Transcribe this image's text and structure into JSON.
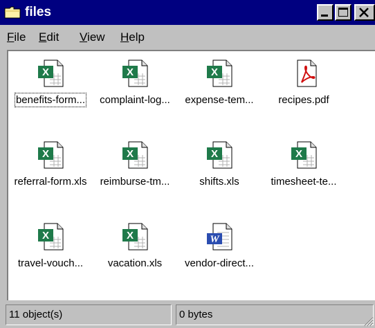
{
  "window": {
    "title": "files",
    "title_icon": "folder-icon",
    "buttons": [
      "minimize-icon",
      "maximize-icon",
      "close-icon"
    ]
  },
  "menu": {
    "items": [
      {
        "label": "File",
        "accel": "F",
        "rest": "ile"
      },
      {
        "label": "Edit",
        "accel": "E",
        "rest": "dit"
      },
      {
        "label": "View",
        "accel": "V",
        "rest": "iew"
      },
      {
        "label": "Help",
        "accel": "H",
        "rest": "elp"
      }
    ]
  },
  "files": [
    {
      "label": "benefits-form...",
      "type": "excel",
      "selected": true
    },
    {
      "label": "complaint-log...",
      "type": "excel"
    },
    {
      "label": "expense-tem...",
      "type": "excel"
    },
    {
      "label": "recipes.pdf",
      "type": "pdf"
    },
    {
      "label": "referral-form.xls",
      "type": "excel"
    },
    {
      "label": "reimburse-tm...",
      "type": "excel"
    },
    {
      "label": "shifts.xls",
      "type": "excel"
    },
    {
      "label": "timesheet-te...",
      "type": "excel"
    },
    {
      "label": "travel-vouch...",
      "type": "excel"
    },
    {
      "label": "vacation.xls",
      "type": "excel"
    },
    {
      "label": "vendor-direct...",
      "type": "word"
    }
  ],
  "status": {
    "objects": "11 object(s)",
    "size": "0 bytes"
  },
  "colors": {
    "titlebar": "#000080",
    "face": "#c0c0c0",
    "excel": "#1f7a4a",
    "word": "#2b4db0",
    "pdf": "#d01010"
  }
}
